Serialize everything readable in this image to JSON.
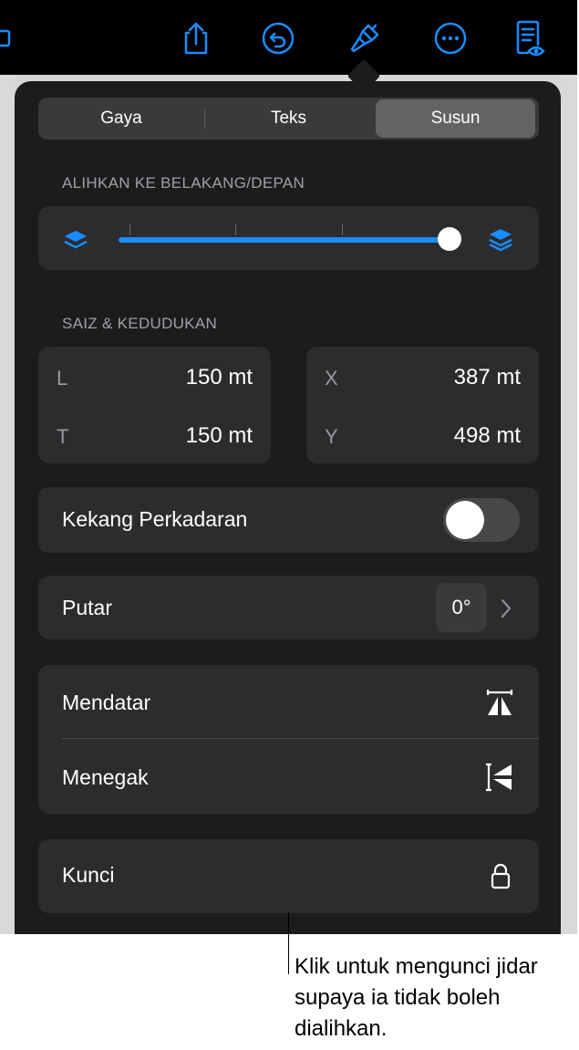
{
  "toolbar": {
    "icons": [
      "share-icon",
      "undo-icon",
      "format-brush-icon",
      "more-icon",
      "reader-view-icon"
    ]
  },
  "tabs": {
    "style": "Gaya",
    "text": "Teks",
    "arrange": "Susun",
    "selected": "Susun"
  },
  "layer": {
    "title": "ALIHKAN KE BELAKANG/DEPAN",
    "slider_value": 1.0
  },
  "size_position": {
    "title": "SAIZ & KEDUDUKAN",
    "width_label": "L",
    "width_value": "150 mt",
    "height_label": "T",
    "height_value": "150 mt",
    "x_label": "X",
    "x_value": "387 mt",
    "y_label": "Y",
    "y_value": "498 mt"
  },
  "constrain": {
    "label": "Kekang Perkadaran",
    "on": false
  },
  "rotate": {
    "label": "Putar",
    "value": "0°"
  },
  "flip": {
    "horizontal": "Mendatar",
    "vertical": "Menegak"
  },
  "lock": {
    "label": "Kunci"
  },
  "callout": {
    "text": "Klik untuk mengunci jidar supaya ia tidak boleh dialihkan."
  },
  "colors": {
    "accent": "#1a8cff",
    "panel": "#1c1c1e",
    "row": "#2c2c2e"
  }
}
